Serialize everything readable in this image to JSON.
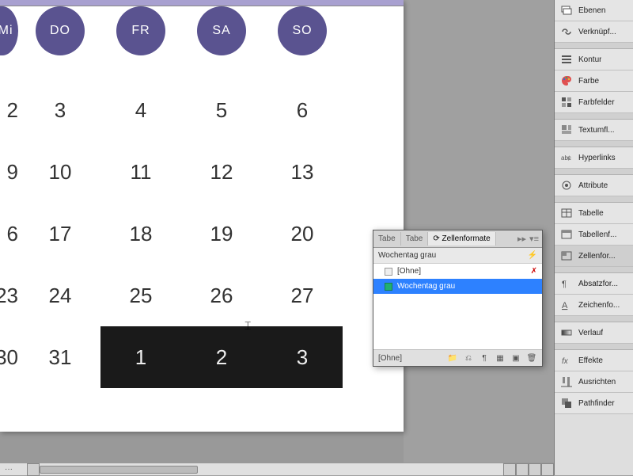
{
  "weekdays": [
    "Mi",
    "DO",
    "FR",
    "SA",
    "SO"
  ],
  "rows": [
    [
      "2",
      "3",
      "4",
      "5",
      "6"
    ],
    [
      "9",
      "10",
      "11",
      "12",
      "13"
    ],
    [
      "6",
      "17",
      "18",
      "19",
      "20"
    ],
    [
      "23",
      "24",
      "25",
      "26",
      "27"
    ],
    [
      "30",
      "31",
      "1",
      "2",
      "3"
    ]
  ],
  "panel": {
    "tab1": "Tabe",
    "tab2": "Tabe",
    "tab3": "Zellenformate",
    "title": "Wochentag grau",
    "item_none": "[Ohne]",
    "item_selected": "Wochentag grau",
    "footer_ohne": "[Ohne]"
  },
  "dock": {
    "ebenen": "Ebenen",
    "verknuepf": "Verknüpf...",
    "kontur": "Kontur",
    "farbe": "Farbe",
    "farbfelder": "Farbfelder",
    "textumfl": "Textumfl...",
    "hyperlinks": "Hyperlinks",
    "attribute": "Attribute",
    "tabelle": "Tabelle",
    "tabellenf": "Tabellenf...",
    "zellenfor": "Zellenfor...",
    "absatzfor": "Absatzfor...",
    "zeichenfo": "Zeichenfo...",
    "verlauf": "Verlauf",
    "effekte": "Effekte",
    "ausrichten": "Ausrichten",
    "pathfinder": "Pathfinder"
  },
  "scroll_pct": "···"
}
